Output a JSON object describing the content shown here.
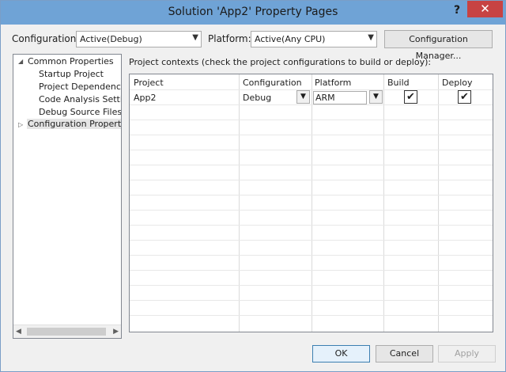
{
  "window": {
    "title": "Solution 'App2' Property Pages",
    "help_glyph": "?",
    "close_glyph": "✕"
  },
  "toolbar": {
    "configuration_label": "Configuration:",
    "configuration_value": "Active(Debug)",
    "platform_label": "Platform:",
    "platform_value": "Active(Any CPU)",
    "config_manager_label": "Configuration Manager..."
  },
  "tree": {
    "items": [
      {
        "label": "Common Properties",
        "expander": "◢"
      },
      {
        "label": "Startup Project"
      },
      {
        "label": "Project Dependencies"
      },
      {
        "label": "Code Analysis Settings"
      },
      {
        "label": "Debug Source Files"
      },
      {
        "label": "Configuration Properties",
        "expander": "▷"
      }
    ],
    "scroll_left": "◀",
    "scroll_right": "▶"
  },
  "contexts": {
    "label": "Project contexts (check the project configurations to build or deploy):",
    "columns": [
      "Project",
      "Configuration",
      "Platform",
      "Build",
      "Deploy"
    ],
    "rows": [
      {
        "project": "App2",
        "configuration": "Debug",
        "platform": "ARM",
        "build": "✔",
        "deploy": "✔"
      }
    ]
  },
  "footer": {
    "ok_label": "OK",
    "cancel_label": "Cancel",
    "apply_label": "Apply"
  }
}
